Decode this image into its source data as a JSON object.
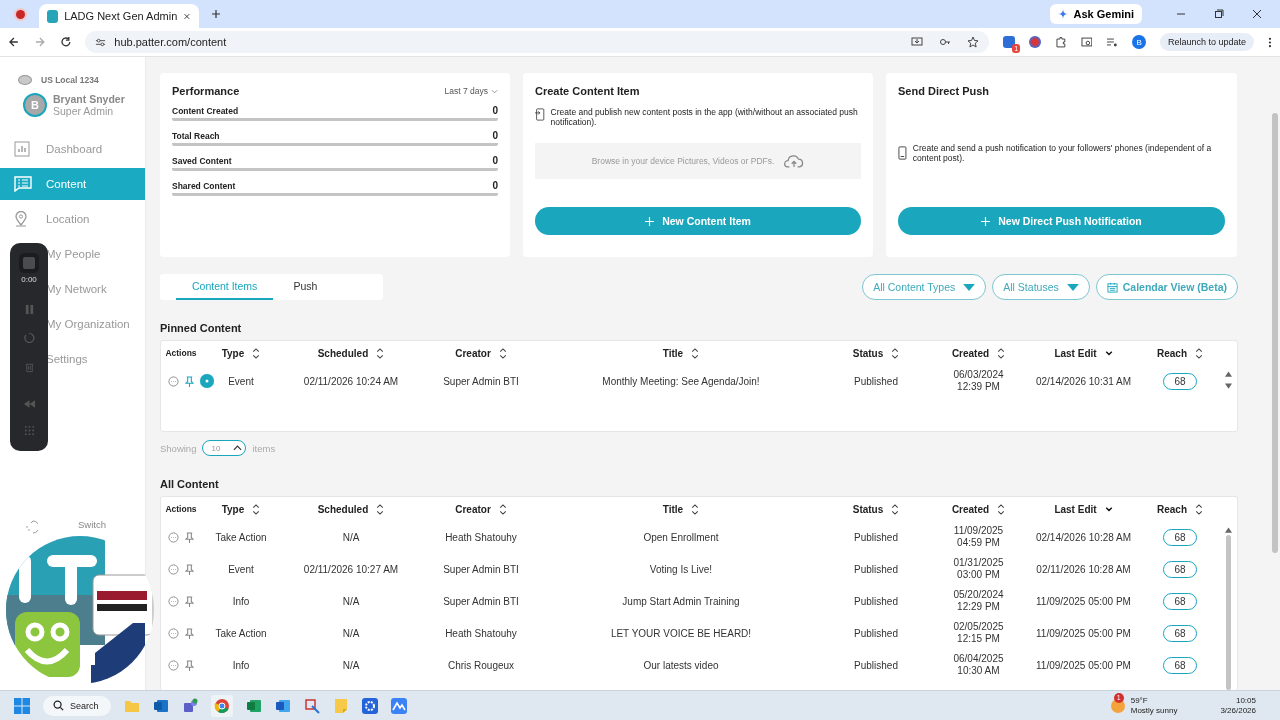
{
  "browser": {
    "tab_title": "LADG Next Gen Admin",
    "url": "hub.patter.com/content",
    "gemini": "Ask Gemini",
    "relaunch": "Relaunch to update",
    "profile": "B",
    "ext_badge": "1"
  },
  "sidebar": {
    "org": "US Local 1234",
    "user": {
      "initial": "B",
      "name": "Bryant Snyder",
      "role": "Super Admin"
    },
    "nav": [
      {
        "label": "Dashboard",
        "selected": false
      },
      {
        "label": "Content",
        "selected": true
      },
      {
        "label": "Location",
        "selected": false
      },
      {
        "label": "My People",
        "selected": false
      },
      {
        "label": "My Network",
        "selected": false
      },
      {
        "label": "My Organization",
        "selected": false
      },
      {
        "label": "Settings",
        "selected": false
      }
    ],
    "switch": "Switch"
  },
  "recorder": {
    "time": "0:00"
  },
  "performance": {
    "title": "Performance",
    "period": "Last 7 days",
    "metrics": [
      {
        "label": "Content Created",
        "value": "0"
      },
      {
        "label": "Total Reach",
        "value": "0"
      },
      {
        "label": "Saved Content",
        "value": "0"
      },
      {
        "label": "Shared Content",
        "value": "0"
      }
    ]
  },
  "create": {
    "title": "Create Content Item",
    "description": "Create and publish new content posts in the app (with/without an associated push notification).",
    "upload_hint": "Browse in your device Pictures, Videos or PDFs.",
    "button": "New Content Item"
  },
  "push": {
    "title": "Send Direct Push",
    "description": "Create and send a push notification to your followers' phones (independent of a content post).",
    "button": "New Direct Push Notification"
  },
  "tabs": [
    {
      "label": "Content Items",
      "selected": true
    },
    {
      "label": "Push",
      "selected": false
    }
  ],
  "filters": [
    "All Content Types",
    "All Statuses"
  ],
  "calendar_button": "Calendar View (Beta)",
  "pinned": {
    "heading": "Pinned Content",
    "actions_header": "Actions",
    "columns": [
      {
        "label": "Type",
        "sorted": false
      },
      {
        "label": "Scheduled",
        "sorted": false
      },
      {
        "label": "Creator",
        "sorted": false
      },
      {
        "label": "Title",
        "sorted": false
      },
      {
        "label": "Status",
        "sorted": false
      },
      {
        "label": "Created",
        "sorted": false
      },
      {
        "label": "Last Edit",
        "sorted": true
      },
      {
        "label": "Reach",
        "sorted": false
      }
    ],
    "rows": [
      {
        "pinned": true,
        "type": "Event",
        "scheduled": "02/11/2026 10:24 AM",
        "creator": "Super Admin BTI",
        "title": "Monthly Meeting: See Agenda/Join!",
        "status": "Published",
        "created": "06/03/2024 12:39 PM",
        "last_edit": "02/14/2026 10:31 AM",
        "reach": "68"
      }
    ]
  },
  "showing": {
    "label": "Showing",
    "count": "10",
    "suffix": "items"
  },
  "all": {
    "heading": "All Content",
    "actions_header": "Actions",
    "columns": [
      {
        "label": "Type",
        "sorted": false
      },
      {
        "label": "Scheduled",
        "sorted": false
      },
      {
        "label": "Creator",
        "sorted": false
      },
      {
        "label": "Title",
        "sorted": false
      },
      {
        "label": "Status",
        "sorted": false
      },
      {
        "label": "Created",
        "sorted": false
      },
      {
        "label": "Last Edit",
        "sorted": true
      },
      {
        "label": "Reach",
        "sorted": false
      }
    ],
    "rows": [
      {
        "pinned": false,
        "type": "Take Action",
        "scheduled": "N/A",
        "creator": "Heath Shatouhy",
        "title": "Open Enrollment",
        "status": "Published",
        "created": "11/09/2025 04:59 PM",
        "last_edit": "02/14/2026 10:28 AM",
        "reach": "68"
      },
      {
        "pinned": false,
        "type": "Event",
        "scheduled": "02/11/2026 10:27 AM",
        "creator": "Super Admin BTI",
        "title": "Voting Is Live!",
        "status": "Published",
        "created": "01/31/2025 03:00 PM",
        "last_edit": "02/11/2026 10:28 AM",
        "reach": "68"
      },
      {
        "pinned": false,
        "type": "Info",
        "scheduled": "N/A",
        "creator": "Super Admin BTI",
        "title": "Jump Start Admin Training",
        "status": "Published",
        "created": "05/20/2024 12:29 PM",
        "last_edit": "11/09/2025 05:00 PM",
        "reach": "68"
      },
      {
        "pinned": false,
        "type": "Take Action",
        "scheduled": "N/A",
        "creator": "Heath Shatouhy",
        "title": "LET YOUR VOICE BE HEARD!",
        "status": "Published",
        "created": "02/05/2025 12:15 PM",
        "last_edit": "11/09/2025 05:00 PM",
        "reach": "68"
      },
      {
        "pinned": false,
        "type": "Info",
        "scheduled": "N/A",
        "creator": "Chris Rougeux",
        "title": "Our latests video",
        "status": "Published",
        "created": "06/04/2025 10:30 AM",
        "last_edit": "11/09/2025 05:00 PM",
        "reach": "68"
      }
    ]
  },
  "taskbar": {
    "search": "Search",
    "weather_badge": "1",
    "temperature": "59°F",
    "condition": "Mostly sunny",
    "time": "10:05",
    "date": "3/26/2026"
  }
}
